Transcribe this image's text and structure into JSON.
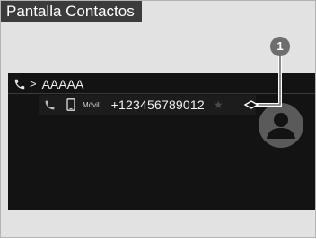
{
  "caption": {
    "title": "Pantalla Contactos"
  },
  "contact": {
    "name": "AAAAA",
    "chevron": ">"
  },
  "number_entry": {
    "type_label": "Móvil",
    "number": "+123456789012",
    "favorite_glyph": "★"
  },
  "callout": {
    "number": "1"
  },
  "colors": {
    "screen_bg": "#131313",
    "row_highlight": "#1c1c1c",
    "caption_bg": "#3b3b3b",
    "callout_bg": "#6e6e6e",
    "frame_bg": "#e2e2e2",
    "avatar_bg": "#5a5a5a",
    "avatar_fg": "#131313"
  },
  "icons": {
    "contact_row": "phone-icon",
    "number_row_call": "phone-icon",
    "number_type": "mobile-phone-icon",
    "favorite": "star-icon",
    "avatar": "person-avatar-icon"
  }
}
